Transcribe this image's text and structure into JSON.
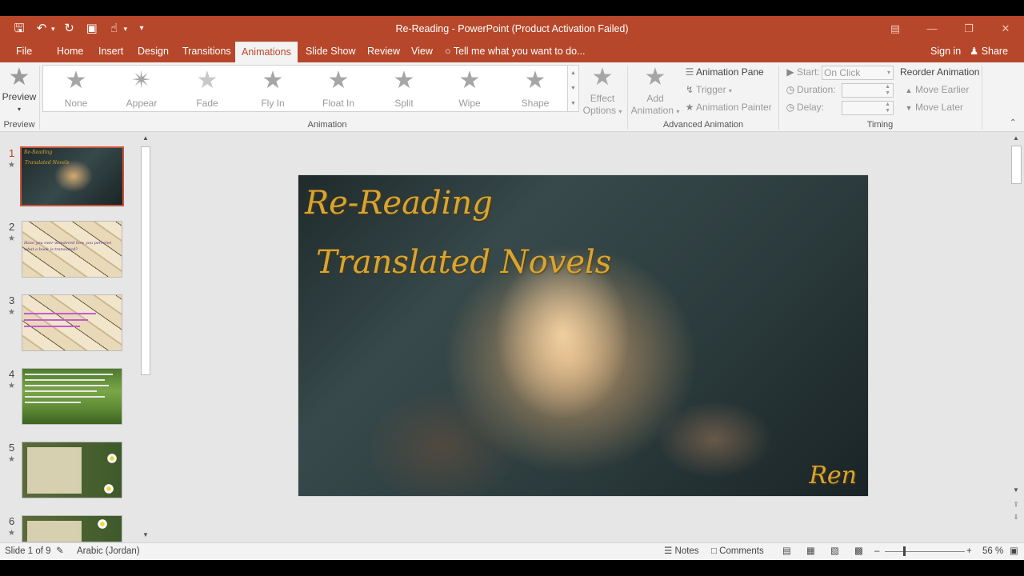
{
  "window": {
    "title": "Re-Reading - PowerPoint (Product Activation Failed)"
  },
  "qat": {
    "save_icon": "save-icon",
    "undo_icon": "undo-icon",
    "redo_icon": "repeat-icon"
  },
  "tabs": [
    {
      "label": "File"
    },
    {
      "label": "Home"
    },
    {
      "label": "Insert"
    },
    {
      "label": "Design"
    },
    {
      "label": "Transitions"
    },
    {
      "label": "Animations"
    },
    {
      "label": "Slide Show"
    },
    {
      "label": "Review"
    },
    {
      "label": "View"
    }
  ],
  "active_tab": "Animations",
  "tellme": "Tell me what you want to do...",
  "account": {
    "signin": "Sign in",
    "share": "Share"
  },
  "ribbon": {
    "preview": {
      "label": "Preview",
      "group": "Preview"
    },
    "animation_gallery": [
      "None",
      "Appear",
      "Fade",
      "Fly In",
      "Float In",
      "Split",
      "Wipe",
      "Shape"
    ],
    "effect_options": {
      "line1": "Effect",
      "line2": "Options"
    },
    "animation_group": "Animation",
    "add_animation": {
      "line1": "Add",
      "line2": "Animation"
    },
    "animation_pane": "Animation Pane",
    "trigger": "Trigger",
    "animation_painter": "Animation Painter",
    "advanced_group": "Advanced Animation",
    "start_label": "Start:",
    "start_value": "On Click",
    "duration_label": "Duration:",
    "delay_label": "Delay:",
    "timing_group": "Timing",
    "reorder": "Reorder Animation",
    "move_earlier": "Move Earlier",
    "move_later": "Move Later"
  },
  "thumbnails": [
    {
      "num": "1",
      "lines": [
        "Re-Reading",
        "Translated Novels"
      ]
    },
    {
      "num": "2",
      "lines": [
        "Have you ever wondered how you perceive",
        "what a book is translated?"
      ]
    },
    {
      "num": "3",
      "lines": [
        "...",
        ""
      ]
    },
    {
      "num": "4",
      "lines": [
        "",
        ""
      ]
    },
    {
      "num": "5",
      "lines": [
        "",
        ""
      ]
    },
    {
      "num": "6",
      "lines": [
        "",
        ""
      ]
    }
  ],
  "slide": {
    "title_line1": "Re-Reading",
    "title_line2": "Translated Novels",
    "author": "Ren"
  },
  "status": {
    "slide_info": "Slide 1 of 9",
    "language": "Arabic (Jordan)",
    "notes": "Notes",
    "comments": "Comments",
    "zoom": "56 %"
  }
}
